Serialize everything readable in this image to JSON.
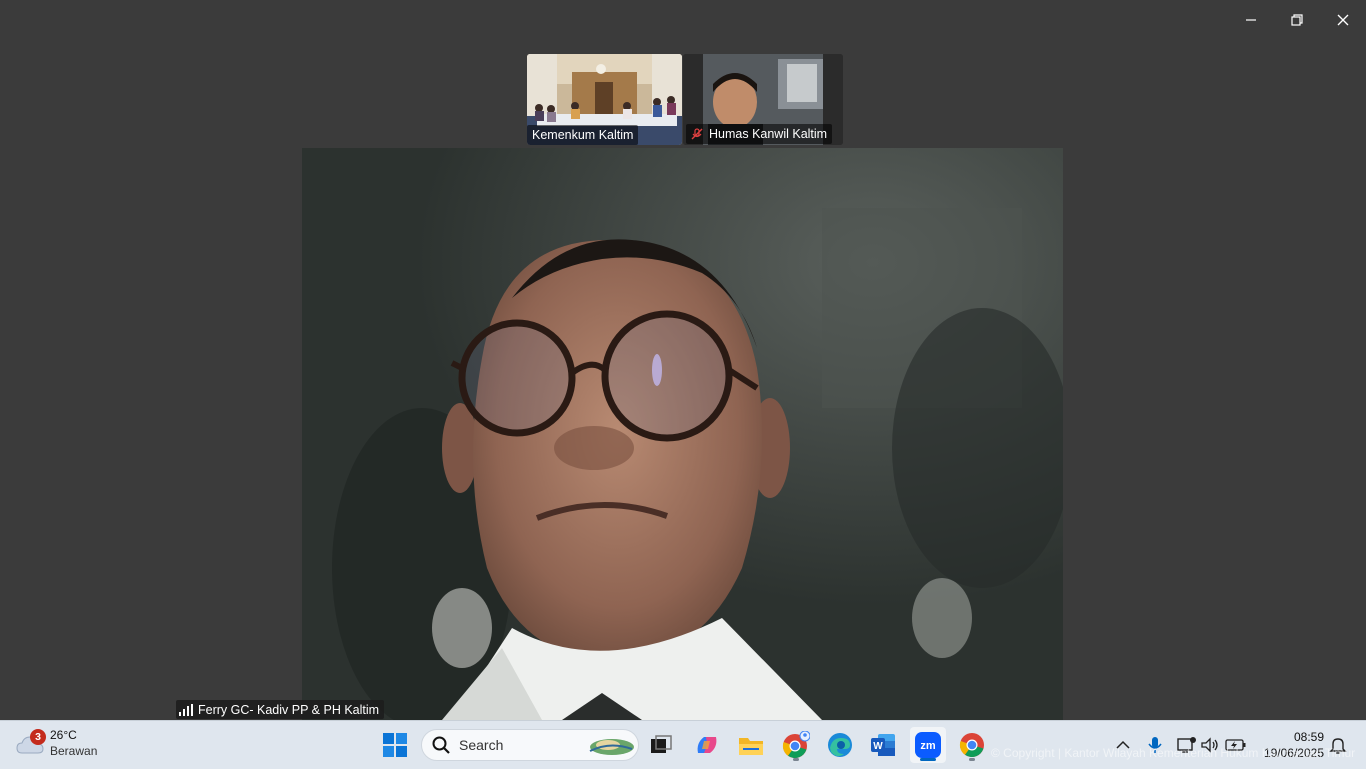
{
  "window": {
    "controls": [
      "minimize",
      "restore",
      "close"
    ]
  },
  "meeting": {
    "thumbnails": [
      {
        "name": "Kemenkum Kaltim",
        "muted": false
      },
      {
        "name": "Humas Kanwil Kaltim",
        "muted": true
      }
    ],
    "active_speaker": {
      "name": "Ferry GC- Kadiv PP & PH Kaltim"
    }
  },
  "watermark": "© Copyright | Kantor Wilayah Kementerian Hukum Kalimantan Timur",
  "taskbar": {
    "weather": {
      "badge": "3",
      "temp": "26°C",
      "condition": "Berawan"
    },
    "search_label": "Search",
    "apps": [
      {
        "name": "windows-start",
        "icon": "windows-logo-icon"
      },
      {
        "name": "task-view",
        "icon": "task-view-icon"
      },
      {
        "name": "copilot",
        "icon": "copilot-icon"
      },
      {
        "name": "file-explorer",
        "icon": "folder-icon"
      },
      {
        "name": "chrome-profile",
        "icon": "chrome-icon"
      },
      {
        "name": "edge",
        "icon": "edge-icon"
      },
      {
        "name": "word",
        "icon": "word-icon"
      },
      {
        "name": "zoom",
        "icon": "zoom-icon"
      },
      {
        "name": "chrome",
        "icon": "chrome-icon"
      }
    ],
    "clock": {
      "time": "08:59",
      "date": "19/06/2025"
    }
  },
  "colors": {
    "background": "#3b3b3b",
    "taskbar": "#dfe6ee",
    "accent": "#0067c0",
    "zoom": "#0b5cff"
  }
}
